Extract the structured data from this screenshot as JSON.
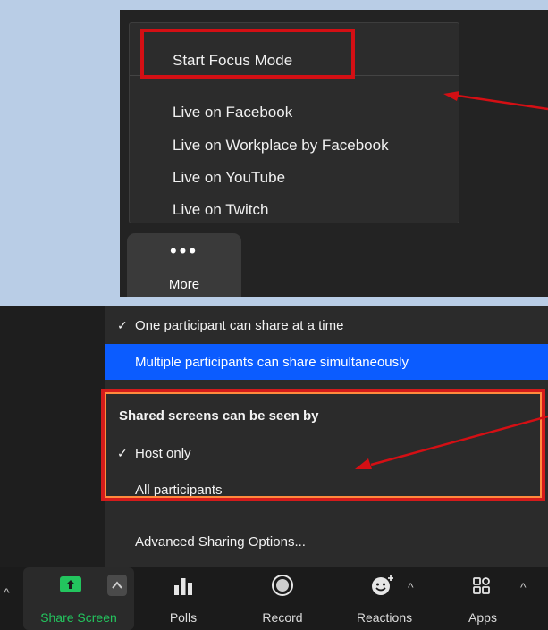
{
  "more_menu": {
    "items": [
      "Start Focus Mode",
      "Live on Facebook",
      "Live on Workplace by Facebook",
      "Live on YouTube",
      "Live on Twitch"
    ],
    "more_button": {
      "dots": "•••",
      "label": "More"
    }
  },
  "share_menu": {
    "option_single": "One participant can share at a time",
    "option_multiple": "Multiple participants can share simultaneously",
    "section_title": "Shared screens can be seen by",
    "option_host": "Host only",
    "option_all": "All participants",
    "advanced": "Advanced Sharing Options...",
    "check_glyph": "✓"
  },
  "toolbar": {
    "share_screen": "Share Screen",
    "polls": "Polls",
    "record": "Record",
    "reactions": "Reactions",
    "apps": "Apps"
  },
  "colors": {
    "highlight_red": "#d40f14",
    "selected_blue": "#0b5cff",
    "share_green": "#23c55e",
    "annotation_orange": "#ff8a3d"
  }
}
